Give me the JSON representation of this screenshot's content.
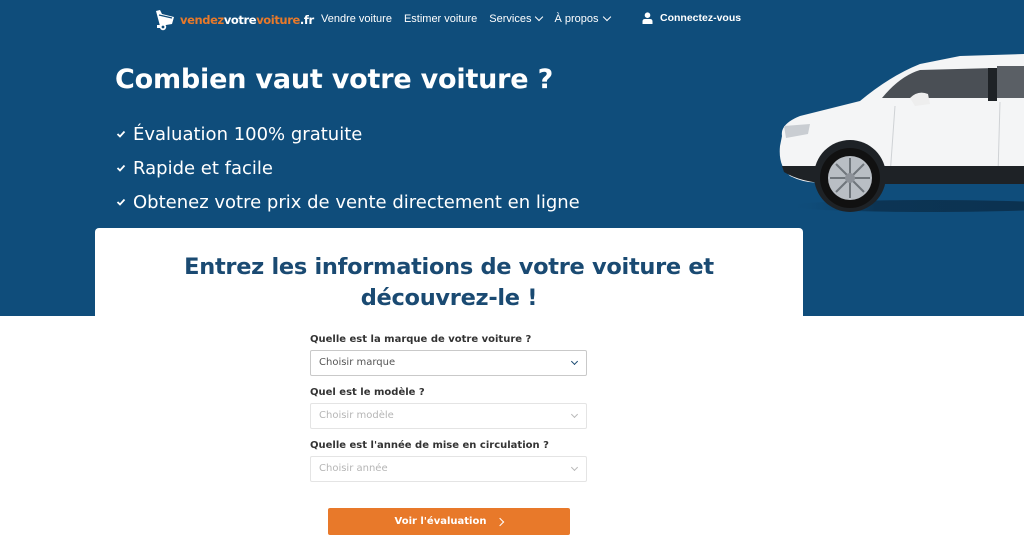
{
  "header": {
    "logo": {
      "part1": "vendez",
      "part2": "votre",
      "part3": "voiture",
      "part4": ".fr"
    },
    "nav": [
      {
        "label": "Vendre voiture",
        "has_dropdown": false
      },
      {
        "label": "Estimer voiture",
        "has_dropdown": false
      },
      {
        "label": "Services",
        "has_dropdown": true
      },
      {
        "label": "À propos",
        "has_dropdown": true
      }
    ],
    "login": {
      "label": "Connectez-vous",
      "icon": "user-icon"
    }
  },
  "hero": {
    "title": "Combien vaut votre voiture ?",
    "benefits": [
      "Évaluation 100% gratuite",
      "Rapide et facile",
      "Obtenez votre prix de vente directement en ligne"
    ]
  },
  "card": {
    "title_line1": "Entrez les informations de votre voiture et",
    "title_line2": "découvrez-le !"
  },
  "form": {
    "fields": [
      {
        "label": "Quelle est la marque de votre voiture ?",
        "value": "Choisir marque",
        "disabled": false
      },
      {
        "label": "Quel est le modèle ?",
        "value": "Choisir modèle",
        "disabled": true
      },
      {
        "label": "Quelle est l'année de mise en circulation ?",
        "value": "Choisir année",
        "disabled": true
      }
    ],
    "submit_label": "Voir l'évaluation"
  },
  "colors": {
    "hero_background": "#0f4d7b",
    "accent_orange": "#e8792a",
    "title_blue": "#1a4a72"
  }
}
